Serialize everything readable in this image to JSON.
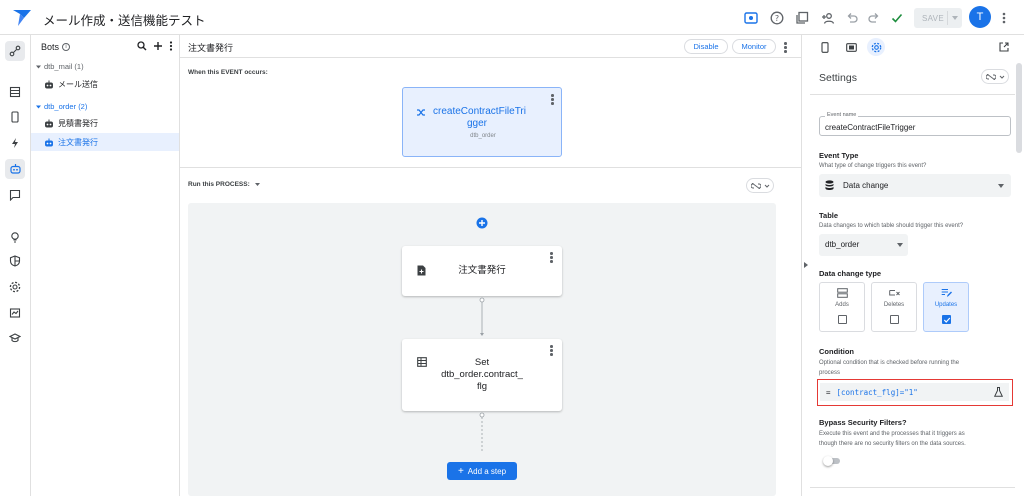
{
  "app": {
    "title": "メール作成・送信機能テスト",
    "avatar_letter": "T",
    "save_label": "SAVE"
  },
  "topbar_icons": [
    "preview-icon",
    "help-icon",
    "copy-icon",
    "share-user-icon",
    "undo-icon",
    "redo-icon",
    "check-icon",
    "more-vert-icon"
  ],
  "rail_icons": [
    "automation-icon",
    "data-icon",
    "app-views-icon",
    "actions-icon",
    "bots-icon",
    "chat-icon",
    "intelligence-icon",
    "security-icon",
    "settings-icon",
    "monitor-icon",
    "learn-icon"
  ],
  "bots_panel": {
    "title": "Bots",
    "groups": [
      {
        "label": "dtb_mail (1)",
        "items": [
          "メール送信"
        ]
      },
      {
        "label": "dtb_order (2)",
        "items": [
          "見積書発行",
          "注文書発行"
        ]
      }
    ]
  },
  "center": {
    "title": "注文書発行",
    "disable_label": "Disable",
    "monitor_label": "Monitor",
    "event_label": "When this EVENT occurs:",
    "event_name_l1": "createContractFileTri",
    "event_name_l2": "gger",
    "event_table": "dtb_order",
    "run_label": "Run this PROCESS:",
    "steps": [
      {
        "lines": [
          "注文書発行"
        ]
      },
      {
        "lines": [
          "Set",
          "dtb_order.contract_",
          "flg"
        ]
      }
    ],
    "add_step_label": "Add a step"
  },
  "settings": {
    "title": "Settings",
    "event_name_label": "Event name",
    "event_name_value": "createContractFileTrigger",
    "event_type_label": "Event Type",
    "event_type_help": "What type of change triggers this event?",
    "event_type_value": "Data change",
    "table_label": "Table",
    "table_help": "Data changes to which table should trigger this event?",
    "table_value": "dtb_order",
    "change_type_label": "Data change type",
    "change_types": [
      {
        "label": "Adds",
        "checked": false
      },
      {
        "label": "Deletes",
        "checked": false
      },
      {
        "label": "Updates",
        "checked": true
      }
    ],
    "condition_label": "Condition",
    "condition_help_l1": "Optional condition that is checked before running the",
    "condition_help_l2": "process",
    "condition_prefix": "=",
    "condition_value": "[contract_flg]=\"1\"",
    "bypass_label": "Bypass Security Filters?",
    "bypass_help_l1": "Execute this event and the processes that it triggers as",
    "bypass_help_l2": "though there are no security filters on the data sources.",
    "bypass_on": false
  },
  "colors": {
    "accent": "#1a73e8",
    "highlight": "#e53935",
    "selected_bg": "#e8f0fe"
  }
}
